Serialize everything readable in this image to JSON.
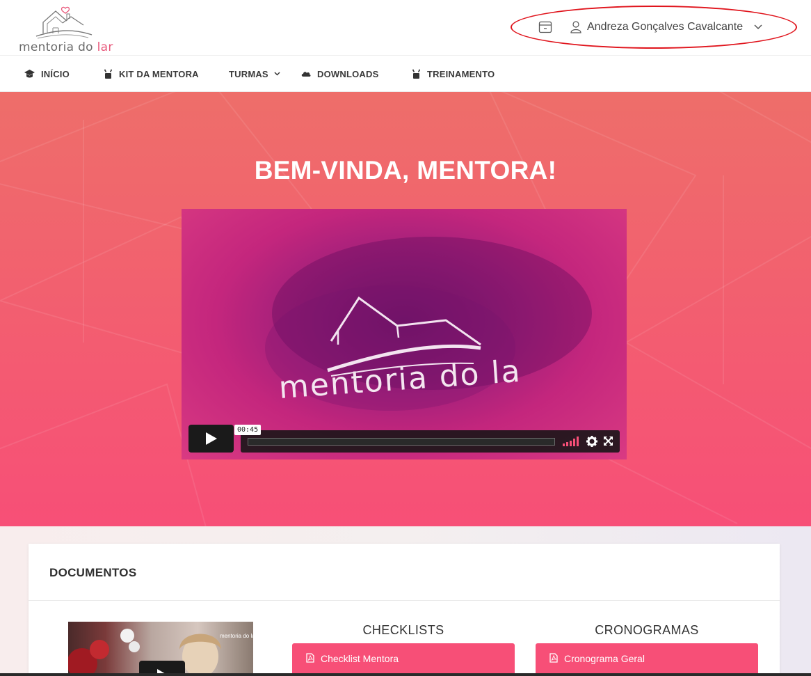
{
  "brand": {
    "logo_text_main": "mentoria do ",
    "logo_text_accent": "lar",
    "accent_color": "#f74f77",
    "highlight_color": "#e0141c"
  },
  "header": {
    "calendar_icon": "calendar-icon",
    "user_icon": "user-icon",
    "user_name": "Andreza Gonçalves Cavalcante",
    "chevron_icon": "chevron-down-icon"
  },
  "nav": {
    "items": [
      {
        "label": "INÍCIO",
        "icon": "graduation-cap-icon"
      },
      {
        "label": "KIT DA MENTORA",
        "icon": "tools-icon"
      },
      {
        "label": "TURMAS",
        "icon": "chevron-down-icon"
      },
      {
        "label": "DOWNLOADS",
        "icon": "cloud-icon"
      },
      {
        "label": "TREINAMENTO",
        "icon": "tools-icon"
      }
    ]
  },
  "hero": {
    "title": "BEM-VINDA, MENTORA!",
    "video": {
      "overlay_text": "mentoria do la",
      "time": "00:45",
      "play_icon": "play-icon",
      "volume_icon": "volume-icon",
      "settings_icon": "gear-icon",
      "fullscreen_icon": "fullscreen-icon"
    }
  },
  "documents": {
    "title": "DOCUMENTOS",
    "thumb_logo": "mentoria do lar",
    "columns": [
      {
        "title": "CHECKLISTS",
        "items": [
          "Checklist Mentora"
        ]
      },
      {
        "title": "CRONOGRAMAS",
        "items": [
          "Cronograma Geral"
        ]
      }
    ]
  }
}
